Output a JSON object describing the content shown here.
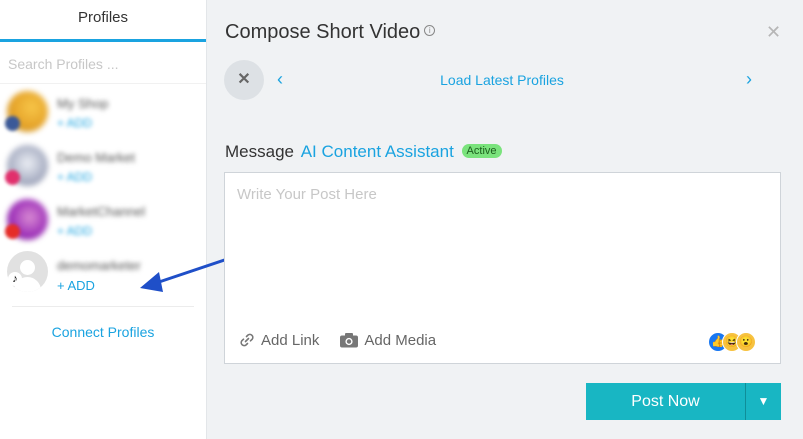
{
  "sidebar": {
    "tab_label": "Profiles",
    "search_placeholder": "Search Profiles ...",
    "profiles": [
      {
        "name": "My Shop",
        "action": "+ ADD",
        "network": "facebook"
      },
      {
        "name": "Demo Market",
        "action": "+ ADD",
        "network": "instagram"
      },
      {
        "name": "MarketChannel",
        "action": "+ ADD",
        "network": "youtube"
      },
      {
        "name": "demomarketer",
        "action": "+ ADD",
        "network": "tiktok"
      }
    ],
    "connect_label": "Connect Profiles"
  },
  "composer": {
    "title": "Compose Short Video",
    "info_icon": "info-icon",
    "close_icon": "close-icon",
    "load_latest_label": "Load Latest Profiles",
    "message_label": "Message",
    "ai_assistant_label": "AI Content Assistant",
    "ai_status": "Active",
    "post_placeholder": "Write Your Post Here",
    "add_link_label": "Add Link",
    "add_media_label": "Add Media",
    "post_now_label": "Post Now"
  },
  "colors": {
    "accent": "#1aa3e0",
    "post_button": "#18b6c3",
    "active_badge": "#7ae37c",
    "annotation_arrow": "#1f4fc8"
  }
}
